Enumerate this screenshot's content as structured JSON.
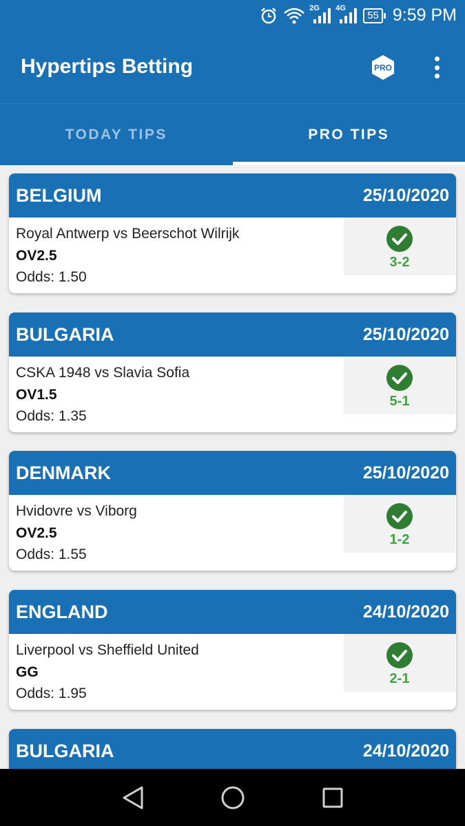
{
  "status_bar": {
    "net1": "2G",
    "net2": "4G",
    "battery": "55",
    "time": "9:59 PM"
  },
  "app_bar": {
    "title": "Hypertips Betting",
    "pro_badge": "PRO"
  },
  "tabs": [
    {
      "label": "TODAY TIPS",
      "active": false
    },
    {
      "label": "PRO TIPS",
      "active": true
    }
  ],
  "tips": [
    {
      "country": "BELGIUM",
      "date": "25/10/2020",
      "match": "Royal Antwerp vs Beerschot Wilrijk",
      "tip": "OV2.5",
      "odds": "Odds: 1.50",
      "score": "3-2"
    },
    {
      "country": "BULGARIA",
      "date": "25/10/2020",
      "match": "CSKA 1948 vs Slavia Sofia",
      "tip": "OV1.5",
      "odds": "Odds: 1.35",
      "score": "5-1"
    },
    {
      "country": "DENMARK",
      "date": "25/10/2020",
      "match": "Hvidovre vs Viborg",
      "tip": "OV2.5",
      "odds": "Odds: 1.55",
      "score": "1-2"
    },
    {
      "country": "ENGLAND",
      "date": "24/10/2020",
      "match": "Liverpool vs Sheffield United",
      "tip": "GG",
      "odds": "Odds: 1.95",
      "score": "2-1"
    },
    {
      "country": "BULGARIA",
      "date": "24/10/2020",
      "match": "",
      "tip": "",
      "odds": "",
      "score": ""
    }
  ],
  "colors": {
    "primary": "#1a70b5",
    "win": "#43a047"
  }
}
